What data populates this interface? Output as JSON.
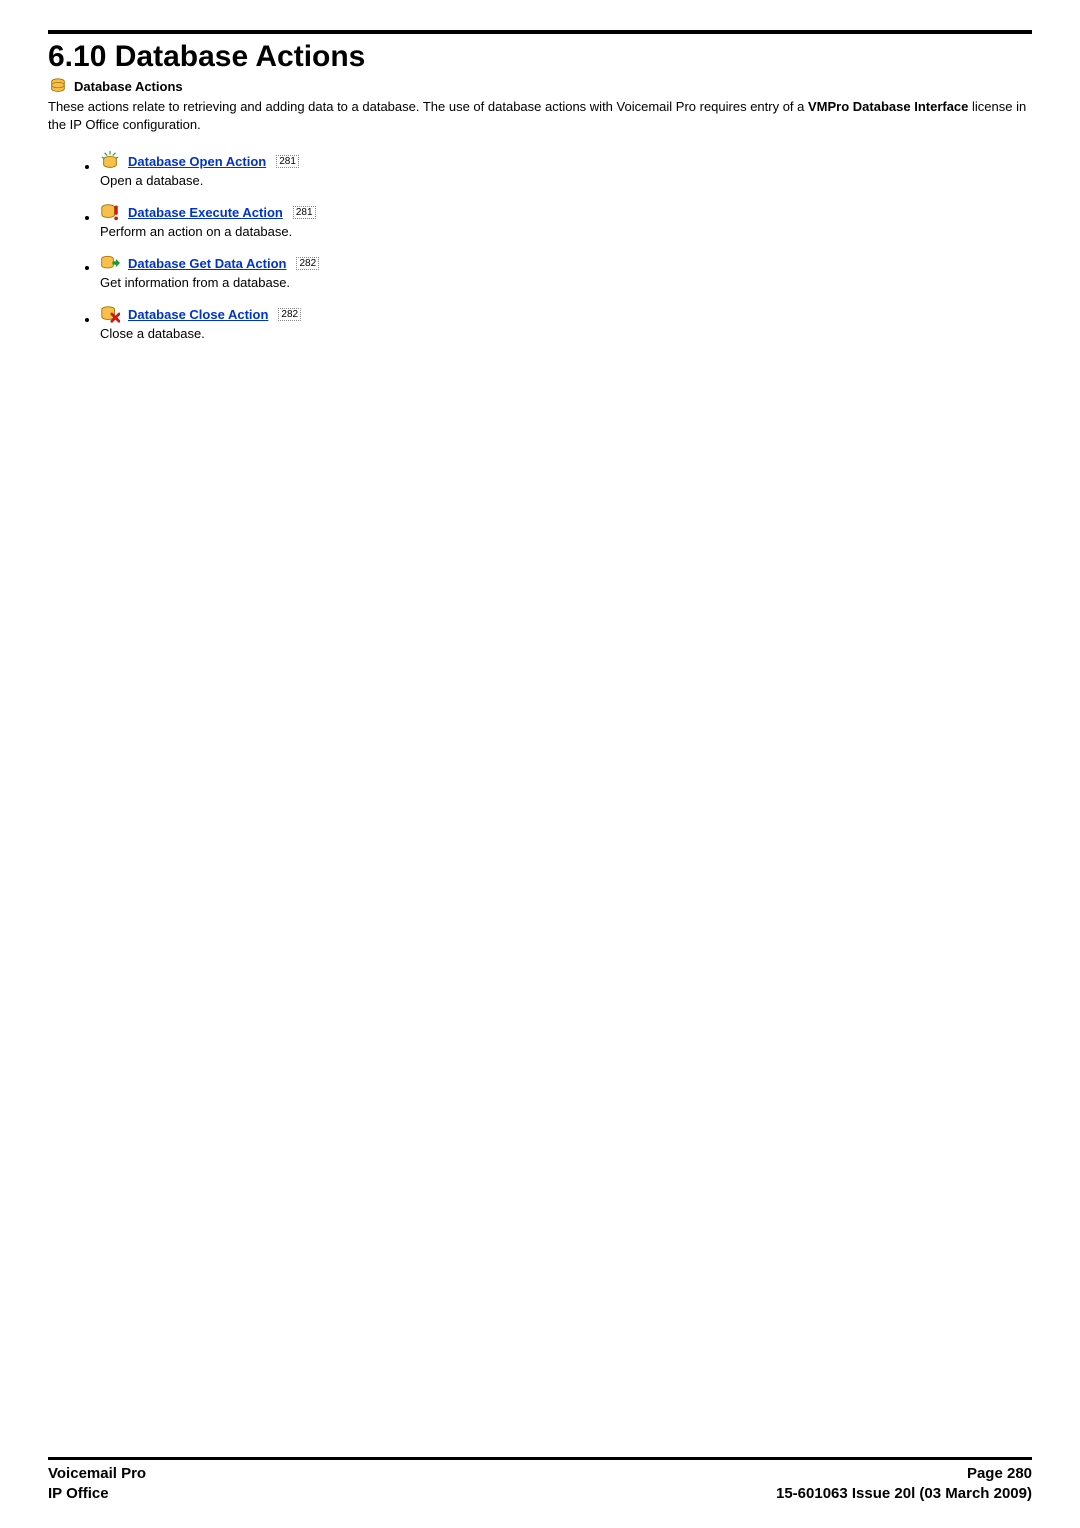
{
  "header": {
    "title": "6.10 Database Actions",
    "section_label": "Database Actions",
    "intro_prefix": "These actions relate to retrieving and adding data to a database. The use of database actions with Voicemail Pro requires entry of a ",
    "intro_bold": "VMPro Database Interface",
    "intro_suffix": " license in the IP Office configuration."
  },
  "items": [
    {
      "label": "Database Open Action",
      "pageref": "281",
      "desc": "Open a database."
    },
    {
      "label": "Database Execute Action",
      "pageref": "281",
      "desc": "Perform an action on a database."
    },
    {
      "label": "Database Get Data Action",
      "pageref": "282",
      "desc": "Get information from a database."
    },
    {
      "label": "Database Close Action",
      "pageref": "282",
      "desc": "Close a database."
    }
  ],
  "footer": {
    "left_line1": "Voicemail Pro",
    "left_line2": "IP Office",
    "right_line1": "Page 280",
    "right_line2": "15-601063 Issue 20l (03 March 2009)"
  }
}
